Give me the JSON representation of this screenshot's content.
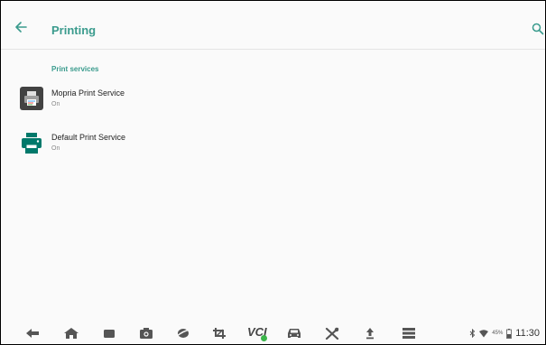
{
  "header": {
    "title": "Printing",
    "back_icon": "arrow-left-icon",
    "search_icon": "search-icon"
  },
  "section": {
    "title": "Print services"
  },
  "services": [
    {
      "name": "Mopria Print Service",
      "status": "On",
      "icon": "mopria-printer-icon"
    },
    {
      "name": "Default Print Service",
      "status": "On",
      "icon": "printer-icon"
    }
  ],
  "navbar": {
    "vci_label": "VCI",
    "icons": [
      "back-icon",
      "home-icon",
      "recent-apps-icon",
      "camera-icon",
      "browser-icon",
      "crop-icon",
      "vci-icon",
      "car-icon",
      "tools-icon",
      "upload-icon",
      "menu-icon"
    ]
  },
  "status_bar": {
    "battery_percent": "45%",
    "time": "11:30",
    "icons": [
      "bluetooth-icon",
      "wifi-icon",
      "battery-icon"
    ]
  },
  "colors": {
    "accent": "#3a9b8d",
    "printer_green": "#00796b",
    "mopria_dark": "#424242",
    "background": "#fafafa"
  }
}
